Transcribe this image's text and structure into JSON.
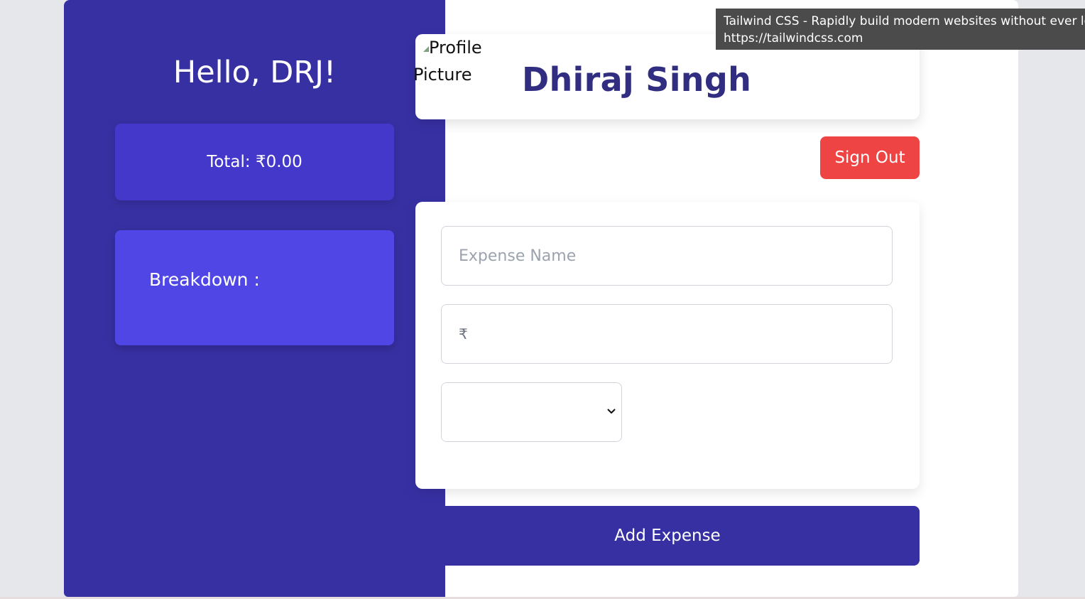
{
  "sidebar": {
    "greeting": "Hello, DRJ!",
    "total_label": "Total: ₹0.00",
    "breakdown_label": "Breakdown :"
  },
  "profile": {
    "picture_alt": "Profile Picture",
    "picture_alt_line1": "Profile",
    "picture_alt_line2": "Picture",
    "name": "Dhiraj Singh"
  },
  "actions": {
    "sign_out_label": "Sign Out",
    "add_expense_label": "Add Expense"
  },
  "form": {
    "expense_name_placeholder": "Expense Name",
    "expense_name_value": "",
    "amount_currency_symbol": "₹",
    "amount_value": "",
    "category_selected": ""
  },
  "tooltip": {
    "title": "Tailwind CSS - Rapidly build modern websites without ever leaving your HTML",
    "url": "https://tailwindcss.com"
  },
  "colors": {
    "sidebar_bg": "#3730a3",
    "total_card_bg": "#4338ca",
    "breakdown_card_bg": "#4f46e5",
    "name_text": "#312e81",
    "sign_out_bg": "#ef4444",
    "add_expense_bg": "#3730a3"
  },
  "icons": {
    "broken_image": "broken-image-icon",
    "select_arrow": "chevron-down-icon"
  }
}
